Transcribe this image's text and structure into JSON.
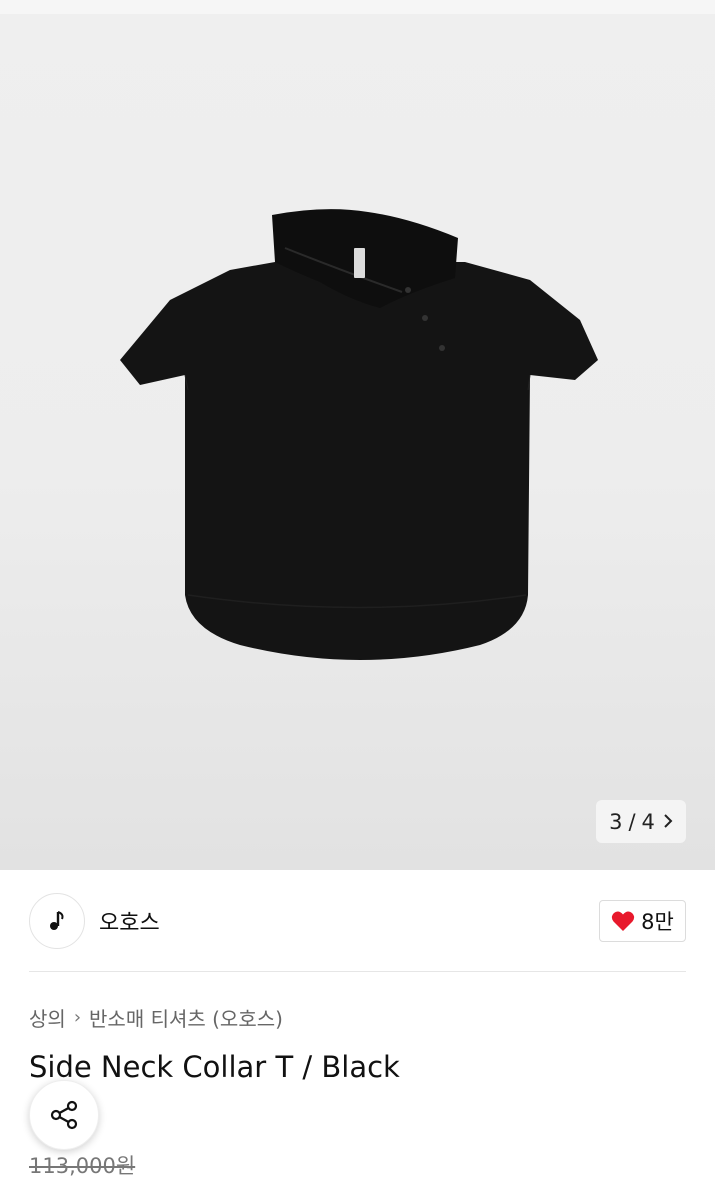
{
  "gallery": {
    "image_alt": "Side Neck Collar T / Black product photo",
    "current_page": "3",
    "total_pages": "4",
    "page_separator": "/"
  },
  "brand": {
    "name": "오호스",
    "likes": "8만"
  },
  "breadcrumb": {
    "items": [
      "상의",
      "반소매 티셔츠 (오호스)"
    ]
  },
  "product": {
    "title": "Side Neck Collar T / Black",
    "original_price": "113,000원"
  },
  "colors": {
    "accent_red": "#e8192c",
    "shirt": "#141414"
  },
  "icons": {
    "brand_logo": "note-logo-icon",
    "like": "heart-icon",
    "share": "share-icon",
    "next": "chevron-right-icon"
  }
}
